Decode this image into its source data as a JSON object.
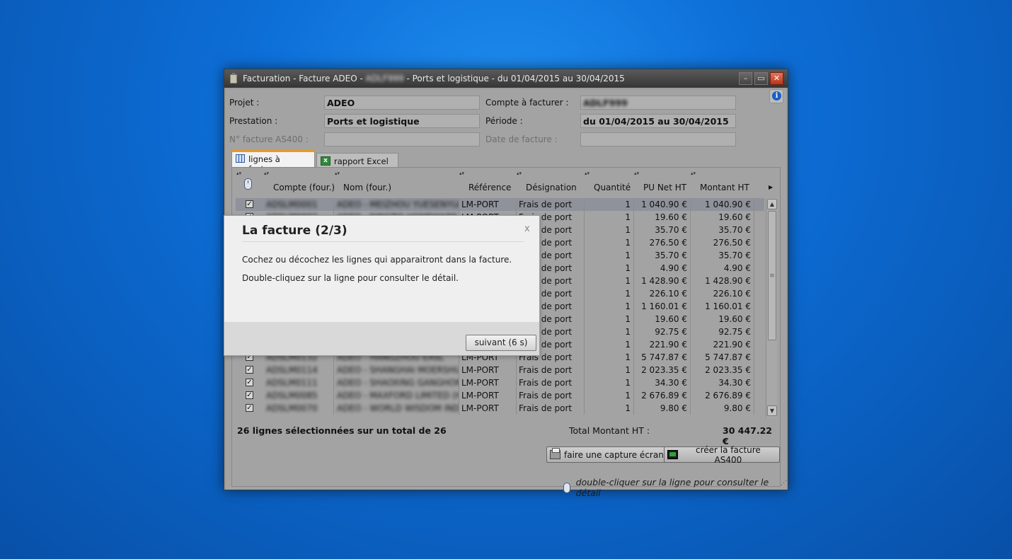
{
  "window": {
    "title_prefix": "Facturation - Facture ADEO - ",
    "title_blur": "ADLF999",
    "title_suffix": " - Ports et logistique - du 01/04/2015 au 30/04/2015",
    "min_label": "–",
    "max_label": "▭",
    "close_label": "✕"
  },
  "form": {
    "projet_label": "Projet :",
    "projet_value": "ADEO",
    "compte_label": "Compte à facturer :",
    "compte_value": "ADLF999",
    "prestation_label": "Prestation :",
    "prestation_value": "Ports et logistique",
    "periode_label": "Période :",
    "periode_value": "du 01/04/2015 au 30/04/2015",
    "facture_label": "N° facture AS400 :",
    "date_label": "Date de facture :"
  },
  "tabs": [
    {
      "label": "lignes à facturer",
      "icon": "grid-icon"
    },
    {
      "label": "rapport Excel",
      "icon": "excel-icon"
    }
  ],
  "grid": {
    "columns": [
      "Compte (four.)",
      "Nom (four.)",
      "Référence",
      "Désignation",
      "Quantité",
      "PU Net HT",
      "Montant HT"
    ],
    "rows": [
      {
        "compte": "ADSLM0001",
        "nom": "ADEO - MEIZHOU YUESENYUAN",
        "ref": "LM-PORT",
        "des": "Frais de port",
        "qte": "1",
        "pu": "1 040.90 €",
        "montant": "1 040.90 €",
        "checked": "✓"
      },
      {
        "compte": "ADSLM0002",
        "nom": "ADEO - NINGBO HOMEWARE",
        "ref": "LM-PORT",
        "des": "Frais de port",
        "qte": "1",
        "pu": "19.60 €",
        "montant": "19.60 €",
        "checked": "✓"
      },
      {
        "compte": "ADSLM0003",
        "nom": "ADEO - XIAMEN TOOLS CO",
        "ref": "LM-PORT",
        "des": "Frais de port",
        "qte": "1",
        "pu": "35.70 €",
        "montant": "35.70 €",
        "checked": "✓"
      },
      {
        "compte": "ADSLM0004",
        "nom": "ADEO - SHENZHEN LIGHTING",
        "ref": "LM-PORT",
        "des": "Frais de port",
        "qte": "1",
        "pu": "276.50 €",
        "montant": "276.50 €",
        "checked": "✓"
      },
      {
        "compte": "ADSLM0005",
        "nom": "ADEO - HANGZHOU GARDEN",
        "ref": "LM-PORT",
        "des": "Frais de port",
        "qte": "1",
        "pu": "35.70 €",
        "montant": "35.70 €",
        "checked": "✓"
      },
      {
        "compte": "ADSLM0006",
        "nom": "ADEO - FOSHAN CERAMICS",
        "ref": "LM-PORT",
        "des": "Frais de port",
        "qte": "1",
        "pu": "4.90 €",
        "montant": "4.90 €",
        "checked": "✓"
      },
      {
        "compte": "ADSLM0007",
        "nom": "ADEO - JIANGSU HARDWARE",
        "ref": "LM-PORT",
        "des": "Frais de port",
        "qte": "1",
        "pu": "1 428.90 €",
        "montant": "1 428.90 €",
        "checked": "✓"
      },
      {
        "compte": "ADSLM0008",
        "nom": "ADEO - QINGDAO PAINTS",
        "ref": "LM-PORT",
        "des": "Frais de port",
        "qte": "1",
        "pu": "226.10 €",
        "montant": "226.10 €",
        "checked": "✓"
      },
      {
        "compte": "ADSLM0009",
        "nom": "ADEO - DONGGUAN ELECTRIC",
        "ref": "LM-PORT",
        "des": "Frais de port",
        "qte": "1",
        "pu": "1 160.01 €",
        "montant": "1 160.01 €",
        "checked": "✓"
      },
      {
        "compte": "ADSLM0010",
        "nom": "ADEO - TIANJIN PLUMBING",
        "ref": "LM-PORT",
        "des": "Frais de port",
        "qte": "1",
        "pu": "19.60 €",
        "montant": "19.60 €",
        "checked": "✓"
      },
      {
        "compte": "ADSLM0011",
        "nom": "ADEO - WENZHOU VALVES",
        "ref": "LM-PORT",
        "des": "Frais de port",
        "qte": "1",
        "pu": "92.75 €",
        "montant": "92.75 €",
        "checked": "✓"
      },
      {
        "compte": "ADSLM0012",
        "nom": "ADEO - SUZHOU TEXTILES",
        "ref": "LM-PORT",
        "des": "Frais de port",
        "qte": "1",
        "pu": "221.90 €",
        "montant": "221.90 €",
        "checked": "✓"
      },
      {
        "compte": "ADSLM0132",
        "nom": "ADEO - HANGZHOU EASL",
        "ref": "LM-PORT",
        "des": "Frais de port",
        "qte": "1",
        "pu": "5 747.87 €",
        "montant": "5 747.87 €",
        "checked": "✓"
      },
      {
        "compte": "ADSLM0114",
        "nom": "ADEO - SHANGHAI MOERSHU",
        "ref": "LM-PORT",
        "des": "Frais de port",
        "qte": "1",
        "pu": "2 023.35 €",
        "montant": "2 023.35 €",
        "checked": "✓"
      },
      {
        "compte": "ADSLM0111",
        "nom": "ADEO - SHAOXING GANGHON",
        "ref": "LM-PORT",
        "des": "Frais de port",
        "qte": "1",
        "pu": "34.30 €",
        "montant": "34.30 €",
        "checked": "✓"
      },
      {
        "compte": "ADSLM0085",
        "nom": "ADEO - MAXFORD LIMITED (H",
        "ref": "LM-PORT",
        "des": "Frais de port",
        "qte": "1",
        "pu": "2 676.89 €",
        "montant": "2 676.89 €",
        "checked": "✓"
      },
      {
        "compte": "ADSLM0070",
        "nom": "ADEO - WORLD WISDOM INDU",
        "ref": "LM-PORT",
        "des": "Frais de port",
        "qte": "1",
        "pu": "9.80 €",
        "montant": "9.80 €",
        "checked": "✓"
      }
    ]
  },
  "summary": {
    "selected_text": "26 lignes sélectionnées sur un total de 26",
    "total_label": "Total Montant HT :",
    "total_value": "30 447.22 €"
  },
  "buttons": {
    "capture_label": "faire une capture écran",
    "create_label": "créer la facture AS400"
  },
  "hint": "double-cliquer sur la ligne pour consulter le détail",
  "dialog": {
    "title": "La facture (2/3)",
    "close": "x",
    "line1": "Cochez ou décochez les lignes qui apparaitront dans la facture.",
    "line2": "Double-cliquez sur la ligne pour consulter le détail.",
    "next_label": "suivant (6 s)"
  },
  "colors": {
    "accent_tab": "#e79a2b",
    "desktop": "#0d6fd8",
    "close_button": "#c9452a"
  }
}
